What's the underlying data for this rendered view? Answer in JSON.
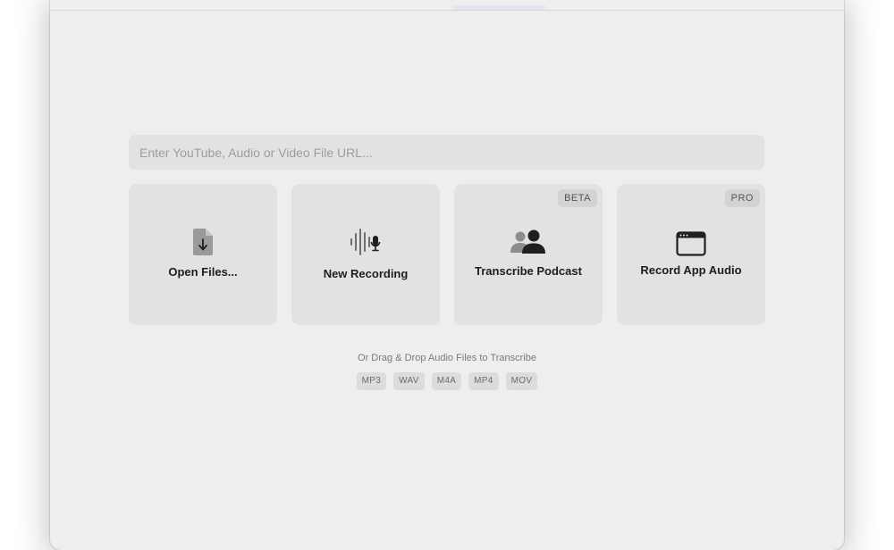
{
  "url_input": {
    "placeholder": "Enter YouTube, Audio or Video File URL..."
  },
  "cards": [
    {
      "label": "Open Files...",
      "icon": "file-download-icon"
    },
    {
      "label": "New Recording",
      "icon": "waveform-mic-icon"
    },
    {
      "label": "Transcribe Podcast",
      "icon": "people-icon",
      "badge": "BETA"
    },
    {
      "label": "Record App Audio",
      "icon": "app-window-icon",
      "badge": "PRO"
    }
  ],
  "drop_hint": "Or Drag & Drop Audio Files to Transcribe",
  "formats": [
    "MP3",
    "WAV",
    "M4A",
    "MP4",
    "MOV"
  ],
  "colors": {
    "window_bg": "#eeeeee",
    "card_bg": "#e2e2e2",
    "badge_bg": "#d3d3d3",
    "icon_color": "#2a2a2a"
  }
}
